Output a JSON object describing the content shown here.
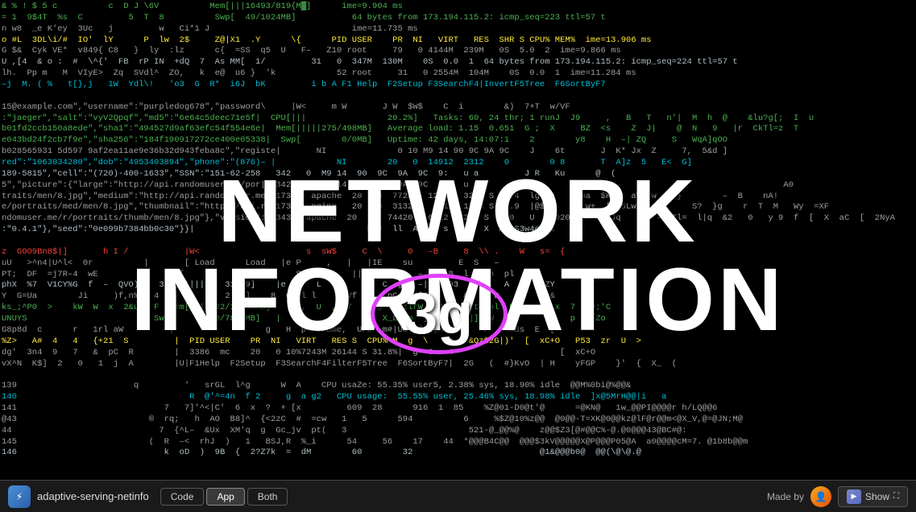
{
  "title": {
    "line1": "NETWORK",
    "line2": "INFORMATION"
  },
  "circle": {
    "text": "3g"
  },
  "bottom_bar": {
    "app_name": "adaptive-serving-netinfo",
    "tabs": [
      {
        "label": "Code",
        "active": false
      },
      {
        "label": "App",
        "active": true
      },
      {
        "label": "Both",
        "active": false
      }
    ],
    "made_by_text": "Made by",
    "show_label": "Show"
  },
  "colors": {
    "accent_purple": "#e040fb",
    "tab_active_bg": "#3a3a3a",
    "bottom_bar_bg": "#1a1a1a"
  }
}
